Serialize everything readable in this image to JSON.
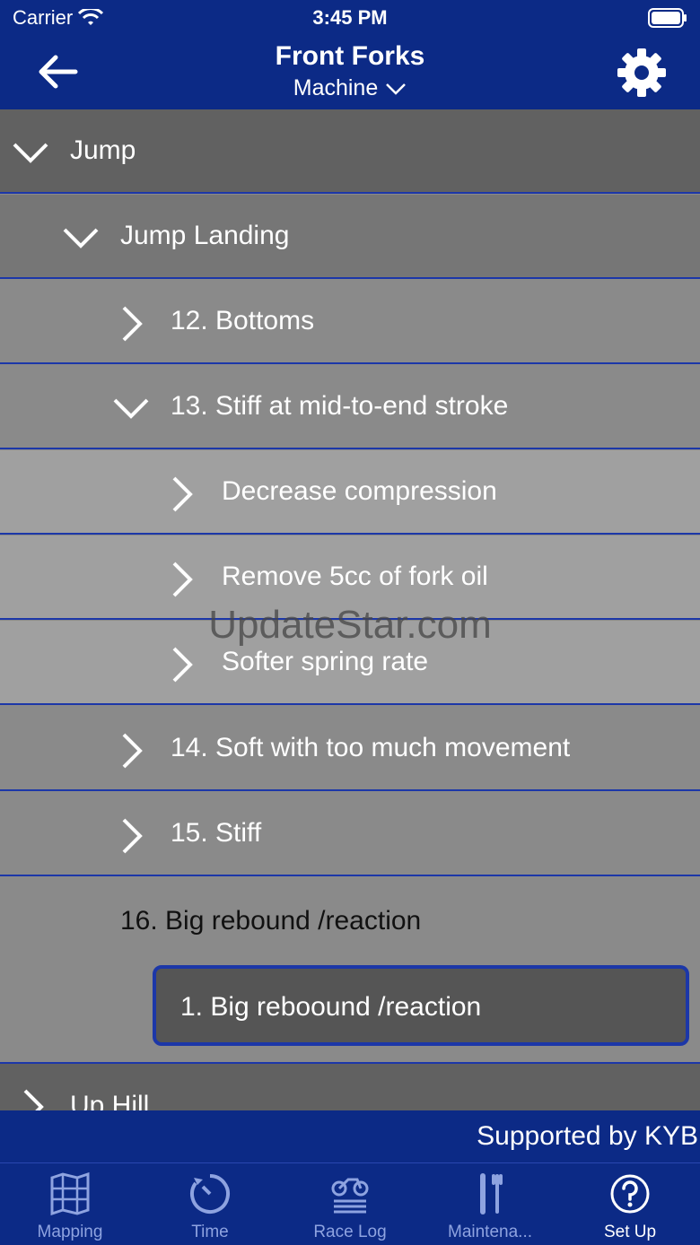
{
  "status": {
    "carrier": "Carrier",
    "time": "3:45 PM"
  },
  "nav": {
    "title": "Front Forks",
    "subtitle": "Machine"
  },
  "list": {
    "jump": "Jump",
    "jump_landing": "Jump Landing",
    "item12": "12. Bottoms",
    "item13": "13. Stiff at mid-to-end stroke",
    "fix1": "Decrease compression",
    "fix2": "Remove 5cc of fork oil",
    "fix3": "Softer spring rate",
    "item14": "14. Soft with too much movement",
    "item15": "15. Stiff",
    "item16": "16. Big rebound /reaction",
    "result": "1. Big reboound /reaction",
    "uphill": "Up Hill"
  },
  "watermark": "UpdateStar.com",
  "footer": {
    "supported": "Supported by KYB"
  },
  "tabs": [
    "Mapping",
    "Time",
    "Race Log",
    "Maintena...",
    "Set Up"
  ],
  "colors": {
    "nav_blue": "#0c2a86",
    "separator_blue": "#1c37a8"
  }
}
